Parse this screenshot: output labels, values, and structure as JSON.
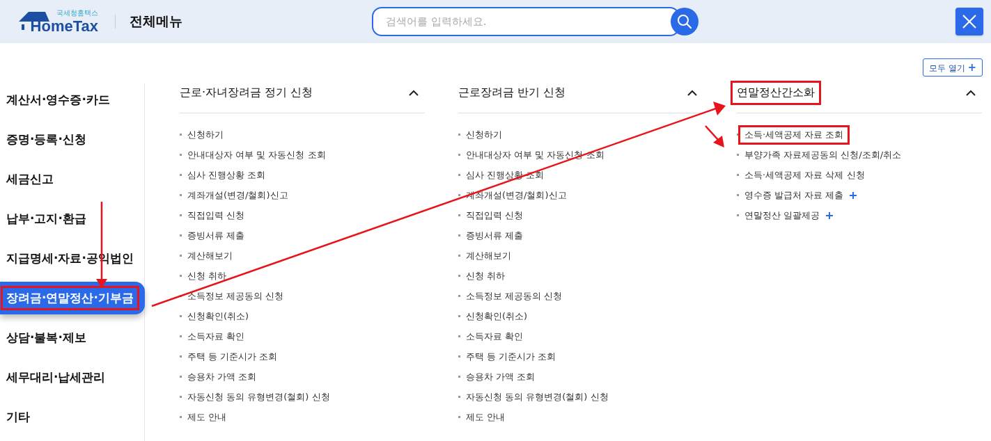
{
  "header": {
    "logo_small": "국세청홈택스",
    "logo_main": "HomeTax",
    "title": "전체메뉴",
    "search": {
      "placeholder": "검색어를 입력하세요."
    }
  },
  "expand_all": {
    "label": "모두 열기",
    "plus": "+"
  },
  "sidebar": {
    "items": [
      {
        "label": "계산서·영수증·카드",
        "selected": false,
        "highlighted": false
      },
      {
        "label": "증명·등록·신청",
        "selected": false,
        "highlighted": false
      },
      {
        "label": "세금신고",
        "selected": false,
        "highlighted": false
      },
      {
        "label": "납부·고지·환급",
        "selected": false,
        "highlighted": false
      },
      {
        "label": "지급명세·자료·공익법인",
        "selected": false,
        "highlighted": false
      },
      {
        "label": "장려금·연말정산·기부금",
        "selected": true,
        "highlighted": true
      },
      {
        "label": "상담·불복·제보",
        "selected": false,
        "highlighted": false
      },
      {
        "label": "세무대리·납세관리",
        "selected": false,
        "highlighted": false
      },
      {
        "label": "기타",
        "selected": false,
        "highlighted": false
      }
    ]
  },
  "columns": [
    {
      "title": "근로·자녀장려금 정기 신청",
      "expanded": true,
      "highlighted": false,
      "items": [
        {
          "label": "신청하기",
          "highlighted": false,
          "has_more": false
        },
        {
          "label": "안내대상자 여부 및 자동신청 조회",
          "highlighted": false,
          "has_more": false
        },
        {
          "label": "심사 진행상황 조회",
          "highlighted": false,
          "has_more": false
        },
        {
          "label": "계좌개설(변경/철회)신고",
          "highlighted": false,
          "has_more": false
        },
        {
          "label": "직접입력 신청",
          "highlighted": false,
          "has_more": false
        },
        {
          "label": "증빙서류 제출",
          "highlighted": false,
          "has_more": false
        },
        {
          "label": "계산해보기",
          "highlighted": false,
          "has_more": false
        },
        {
          "label": "신청 취하",
          "highlighted": false,
          "has_more": false
        },
        {
          "label": "소득정보 제공동의 신청",
          "highlighted": false,
          "has_more": false
        },
        {
          "label": "신청확인(취소)",
          "highlighted": false,
          "has_more": false
        },
        {
          "label": "소득자료 확인",
          "highlighted": false,
          "has_more": false
        },
        {
          "label": "주택 등 기준시가 조회",
          "highlighted": false,
          "has_more": false
        },
        {
          "label": "승용차 가액 조회",
          "highlighted": false,
          "has_more": false
        },
        {
          "label": "자동신청 동의 유형변경(철회) 신청",
          "highlighted": false,
          "has_more": false
        },
        {
          "label": "제도 안내",
          "highlighted": false,
          "has_more": false
        }
      ]
    },
    {
      "title": "근로장려금 반기 신청",
      "expanded": true,
      "highlighted": false,
      "items": [
        {
          "label": "신청하기",
          "highlighted": false,
          "has_more": false
        },
        {
          "label": "안내대상자 여부 및 자동신청 조회",
          "highlighted": false,
          "has_more": false
        },
        {
          "label": "심사 진행상황 조회",
          "highlighted": false,
          "has_more": false
        },
        {
          "label": "계좌개설(변경/철회)신고",
          "highlighted": false,
          "has_more": false
        },
        {
          "label": "직접입력 신청",
          "highlighted": false,
          "has_more": false
        },
        {
          "label": "증빙서류 제출",
          "highlighted": false,
          "has_more": false
        },
        {
          "label": "계산해보기",
          "highlighted": false,
          "has_more": false
        },
        {
          "label": "신청 취하",
          "highlighted": false,
          "has_more": false
        },
        {
          "label": "소득정보 제공동의 신청",
          "highlighted": false,
          "has_more": false
        },
        {
          "label": "신청확인(취소)",
          "highlighted": false,
          "has_more": false
        },
        {
          "label": "소득자료 확인",
          "highlighted": false,
          "has_more": false
        },
        {
          "label": "주택 등 기준시가 조회",
          "highlighted": false,
          "has_more": false
        },
        {
          "label": "승용차 가액 조회",
          "highlighted": false,
          "has_more": false
        },
        {
          "label": "자동신청 동의 유형변경(철회) 신청",
          "highlighted": false,
          "has_more": false
        },
        {
          "label": "제도 안내",
          "highlighted": false,
          "has_more": false
        }
      ]
    },
    {
      "title": "연말정산간소화",
      "expanded": true,
      "highlighted": true,
      "items": [
        {
          "label": "소득·세액공제 자료 조회",
          "highlighted": true,
          "has_more": false
        },
        {
          "label": "부양가족 자료제공동의 신청/조회/취소",
          "highlighted": false,
          "has_more": false
        },
        {
          "label": "소득·세액공제 자료 삭제 신청",
          "highlighted": false,
          "has_more": false
        },
        {
          "label": "영수증 발급처 자료 제출",
          "highlighted": false,
          "has_more": true
        },
        {
          "label": "연말정산 일괄제공",
          "highlighted": false,
          "has_more": true
        }
      ]
    }
  ]
}
